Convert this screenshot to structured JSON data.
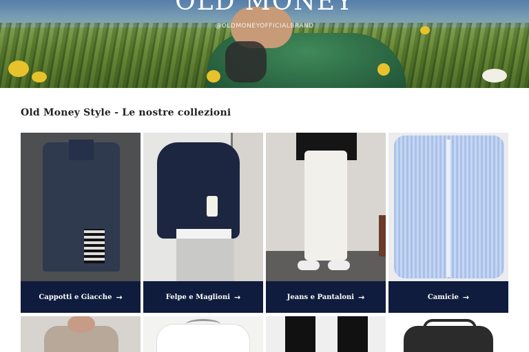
{
  "hero": {
    "brand_title": "OLD MONEY",
    "handle": "@OLDMONEYOFFICIALBRAND"
  },
  "section": {
    "title": "Old Money Style - Le nostre collezioni"
  },
  "collections": [
    {
      "label": "Cappotti e Giacche",
      "arrow": "→"
    },
    {
      "label": "Felpe e Maglioni",
      "arrow": "→"
    },
    {
      "label": "Jeans e Pantaloni",
      "arrow": "→"
    },
    {
      "label": "Camicie",
      "arrow": "→"
    }
  ],
  "colors": {
    "cta_background": "#0f1c3d",
    "cta_text": "#ffffff"
  }
}
